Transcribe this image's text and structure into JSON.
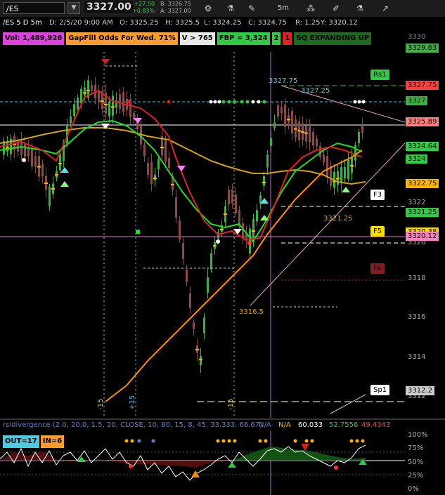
{
  "toolbar": {
    "symbol": "/ES",
    "last_price": "3327.00",
    "change": "+27.50",
    "change_pct": "+0.83%",
    "bid": "B: 3326.75",
    "ask": "A: 3327.00",
    "interval": "5m"
  },
  "header": {
    "title": "/ES 5 D 5m",
    "date": "D: 2/5/20 9:00 AM",
    "open": "O: 3325.25",
    "high": "H: 3325.5",
    "low": "L: 3324.25",
    "close": "C: 3324.75",
    "range": "R: 1.25",
    "y": "Y: 3320.12"
  },
  "studies": {
    "volume": "Vol: 1,489,926",
    "gapfill": "GapFill Odds For Wed. 71%",
    "v": "V > 765",
    "fbp": "FBP = 3,324",
    "num2": "2",
    "num1": "1",
    "sq": "SQ EXPANDING UP"
  },
  "chart_labels": {
    "p1": "3327.75",
    "p2": "3327.25",
    "p3": "3321.25",
    "p4": "3316.5",
    "rs1": "Rs1",
    "f3": "F3",
    "f5": "F5",
    "f6": "F6",
    "sp1": "Sp1",
    "m15a": "-15",
    "p15": "+15",
    "m15b": "-15"
  },
  "price_axis": {
    "ticks": [
      "3322",
      "3320",
      "3318",
      "3316",
      "3314",
      "3312"
    ],
    "flags": [
      {
        "text": "3330",
        "color": "#555555"
      },
      {
        "text": "3329.63",
        "color": "#3cb043"
      },
      {
        "text": "3327.75",
        "color": "#ff4040"
      },
      {
        "text": "3327",
        "color": "#3cb043"
      },
      {
        "text": "3325.89",
        "color": "#ff8080"
      },
      {
        "text": "3324.64",
        "color": "#2ecc40"
      },
      {
        "text": "3324",
        "color": "#2ecc40"
      },
      {
        "text": "3322.75",
        "color": "#ffb400"
      },
      {
        "text": "3321.25",
        "color": "#2ecc40"
      },
      {
        "text": "3320.38",
        "color": "#ffd800"
      },
      {
        "text": "3320.12",
        "color": "#ff80c0"
      },
      {
        "text": "3312.2",
        "color": "#cccccc"
      }
    ]
  },
  "rsi": {
    "title": "rsidivergence (2.0, 20.0, 1.5, 20, CLOSE, 10, 80, 15, 8, 45, 33.333, 66.67)",
    "na1": "N/A",
    "na2": "N/A",
    "v1": "60.033",
    "v2": "52.7556",
    "v3": "49.4343",
    "out": "OUT=17",
    "in": "IN=6",
    "axis": [
      "100%",
      "75%",
      "50%",
      "25%",
      "0%"
    ]
  },
  "colors": {
    "up_candle": "#3cb043",
    "down_candle": "#8b4a4a",
    "green_ma": "#22dd22",
    "red_ma": "#dd2222",
    "orange_ma": "#ff8c00",
    "gold_ma": "#d4a017"
  }
}
